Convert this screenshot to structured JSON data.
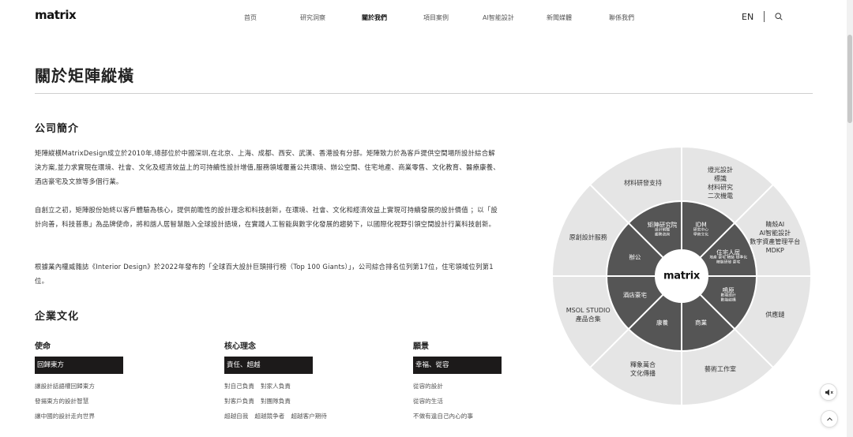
{
  "header": {
    "logo": "matrix",
    "nav": [
      "首页",
      "研究洞察",
      "關於我們",
      "項目案例",
      "AI智能設計",
      "新聞媒體",
      "聯係我們"
    ],
    "active_nav": "關於我們",
    "lang": "EN"
  },
  "page_title": "關於矩陣縱橫",
  "intro": {
    "title": "公司簡介",
    "p1": "矩陣縱橫MatrixDesign成立於2010年,總部位於中國深圳,在北京、上海、成都、西安、武漢、香港設有分部。矩陣致力於為客戶提供空間場所設計綜合解決方案,並力求實現在環境、社會、文化及經濟效益上的可持續性設計增值,服務領域覆蓋公共環境、辦公空間、住宅地產、商業零售、文化教育、醫療康養、酒店豪宅及文旅等多個行業。",
    "p2": "自創立之初，矩陣股份始終以客戶體驗為核心，提供前瞻性的設計理念和科技創新，在環境、社會、文化和經濟效益上實現可持續發展的設計價值 ；以「設計向善，科技普惠」為品牌使命，將和諧人居智慧融入全球設計語境，在實踐人工智能與數字化發展的趨勢下，以國際化視野引領空間設計行業科技創新。",
    "p3": "根據業內權威雜誌《Interior Design》於2022年發布的「全球百大設計巨頭排行榜（Top 100 Giants）」，公司綜合排名位列第17位，住宅領域位列第1位。"
  },
  "culture": {
    "title": "企業文化",
    "columns": [
      {
        "head": "使命",
        "tag": "回歸東方",
        "items": [
          [
            "讓設計話語權回歸東方"
          ],
          [
            "發揚東方的設計智慧"
          ],
          [
            "讓中國的設計走向世界"
          ]
        ]
      },
      {
        "head": "核心理念",
        "tag": "責任、超越",
        "items": [
          [
            "對自己負責",
            "對家人負責"
          ],
          [
            "對客戶負責",
            "對團隊負責"
          ],
          [
            "超越自我",
            "超越競争者",
            "超越客户期待"
          ]
        ]
      },
      {
        "head": "願景",
        "tag": "幸福、從容",
        "items": [
          [
            "從容的設計"
          ],
          [
            "從容的生活"
          ],
          [
            "不做有違自己內心的事"
          ]
        ]
      }
    ]
  },
  "diagram": {
    "center": "matrix",
    "outer": [
      "材料研發支持",
      "燈光設計\n標識\n材料研究\n二次機電",
      "睛殼AI\nAI智能設計\n數字資產管理平台\nMDKP",
      "供應鏈",
      "藝術工作室",
      "釋象萬合\n文化傳播",
      "MSOL STUDIO\n產品合集",
      "原創設計服務"
    ],
    "inner": [
      {
        "label": "矩陣研究院",
        "sub": "設計前瞻\n趨勢咨詢"
      },
      {
        "label": "IDM",
        "sub": "研究中心\n學術文化"
      },
      {
        "label": "住宅人居",
        "sub": "地產 豪宅 精裝 標準化\n精裝研發 豪宅"
      },
      {
        "label": "鳴原",
        "sub": "數能設計\n數能結構"
      },
      {
        "label": "商業",
        "sub": ""
      },
      {
        "label": "康養",
        "sub": ""
      },
      {
        "label": "酒店豪宅",
        "sub": ""
      },
      {
        "label": "辦公",
        "sub": ""
      }
    ],
    "colors": {
      "outer": "#e5e5e5",
      "inner": "#555555",
      "center": "#ffffff",
      "gap": "#ffffff"
    }
  },
  "floating": {
    "icons": [
      "speaker-icon",
      "arrow-up-icon"
    ]
  }
}
